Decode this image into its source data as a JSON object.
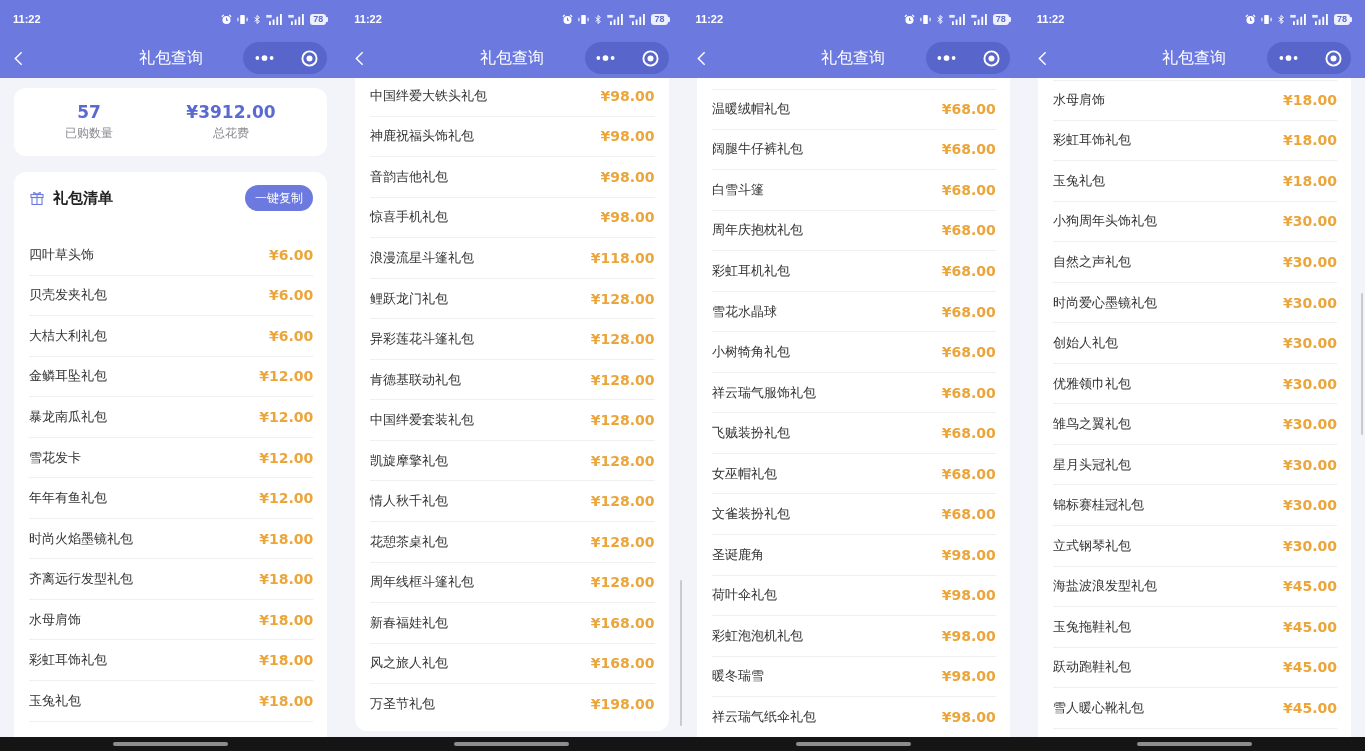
{
  "screens": [
    {
      "status_bar": {
        "time": "11:22",
        "battery": "78"
      },
      "nav_bar": {
        "title": "礼包查询"
      },
      "summary": [
        {
          "value": "57",
          "label": "已购数量"
        },
        {
          "value": "¥3912.00",
          "label": "总花费"
        }
      ],
      "list": {
        "title": "礼包清单",
        "copy_button": "一键复制",
        "items": [
          {
            "name": "四叶草头饰",
            "price": "¥6.00"
          },
          {
            "name": "贝壳发夹礼包",
            "price": "¥6.00"
          },
          {
            "name": "大桔大利礼包",
            "price": "¥6.00"
          },
          {
            "name": "金鳞耳坠礼包",
            "price": "¥12.00"
          },
          {
            "name": "暴龙南瓜礼包",
            "price": "¥12.00"
          },
          {
            "name": "雪花发卡",
            "price": "¥12.00"
          },
          {
            "name": "年年有鱼礼包",
            "price": "¥12.00"
          },
          {
            "name": "时尚火焰墨镜礼包",
            "price": "¥18.00"
          },
          {
            "name": "齐离远行发型礼包",
            "price": "¥18.00"
          },
          {
            "name": "水母肩饰",
            "price": "¥18.00"
          },
          {
            "name": "彩虹耳饰礼包",
            "price": "¥18.00"
          },
          {
            "name": "玉兔礼包",
            "price": "¥18.00"
          }
        ]
      }
    },
    {
      "status_bar": {
        "time": "11:22",
        "battery": "78"
      },
      "nav_bar": {
        "title": "礼包查询"
      },
      "list": {
        "items": [
          {
            "name": "中国绊爱大铁头礼包",
            "price": "¥98.00"
          },
          {
            "name": "神鹿祝福头饰礼包",
            "price": "¥98.00"
          },
          {
            "name": "音韵吉他礼包",
            "price": "¥98.00"
          },
          {
            "name": "惊喜手机礼包",
            "price": "¥98.00"
          },
          {
            "name": "浪漫流星斗篷礼包",
            "price": "¥118.00"
          },
          {
            "name": "鲤跃龙门礼包",
            "price": "¥128.00"
          },
          {
            "name": "异彩莲花斗篷礼包",
            "price": "¥128.00"
          },
          {
            "name": "肯德基联动礼包",
            "price": "¥128.00"
          },
          {
            "name": "中国绊爱套装礼包",
            "price": "¥128.00"
          },
          {
            "name": "凯旋摩擎礼包",
            "price": "¥128.00"
          },
          {
            "name": "情人秋千礼包",
            "price": "¥128.00"
          },
          {
            "name": "花憩茶桌礼包",
            "price": "¥128.00"
          },
          {
            "name": "周年线框斗篷礼包",
            "price": "¥128.00"
          },
          {
            "name": "新春福娃礼包",
            "price": "¥168.00"
          },
          {
            "name": "风之旅人礼包",
            "price": "¥168.00"
          },
          {
            "name": "万圣节礼包",
            "price": "¥198.00"
          }
        ]
      }
    },
    {
      "status_bar": {
        "time": "11:22",
        "battery": "78"
      },
      "nav_bar": {
        "title": "礼包查询"
      },
      "list": {
        "items": [
          {
            "name": "温暖绒帽礼包",
            "price": "¥68.00"
          },
          {
            "name": "阔腿牛仔裤礼包",
            "price": "¥68.00"
          },
          {
            "name": "白雪斗篷",
            "price": "¥68.00"
          },
          {
            "name": "周年庆抱枕礼包",
            "price": "¥68.00"
          },
          {
            "name": "彩虹耳机礼包",
            "price": "¥68.00"
          },
          {
            "name": "雪花水晶球",
            "price": "¥68.00"
          },
          {
            "name": "小树犄角礼包",
            "price": "¥68.00"
          },
          {
            "name": "祥云瑞气服饰礼包",
            "price": "¥68.00"
          },
          {
            "name": "飞贼装扮礼包",
            "price": "¥68.00"
          },
          {
            "name": "女巫帽礼包",
            "price": "¥68.00"
          },
          {
            "name": "文雀装扮礼包",
            "price": "¥68.00"
          },
          {
            "name": "圣诞鹿角",
            "price": "¥98.00"
          },
          {
            "name": "荷叶伞礼包",
            "price": "¥98.00"
          },
          {
            "name": "彩虹泡泡机礼包",
            "price": "¥98.00"
          },
          {
            "name": "暖冬瑞雪",
            "price": "¥98.00"
          },
          {
            "name": "祥云瑞气纸伞礼包",
            "price": "¥98.00"
          }
        ]
      }
    },
    {
      "status_bar": {
        "time": "11:22",
        "battery": "78"
      },
      "nav_bar": {
        "title": "礼包查询"
      },
      "list": {
        "items": [
          {
            "name": "水母肩饰",
            "price": "¥18.00"
          },
          {
            "name": "彩虹耳饰礼包",
            "price": "¥18.00"
          },
          {
            "name": "玉兔礼包",
            "price": "¥18.00"
          },
          {
            "name": "小狗周年头饰礼包",
            "price": "¥30.00"
          },
          {
            "name": "自然之声礼包",
            "price": "¥30.00"
          },
          {
            "name": "时尚爱心墨镜礼包",
            "price": "¥30.00"
          },
          {
            "name": "创始人礼包",
            "price": "¥30.00"
          },
          {
            "name": "优雅领巾礼包",
            "price": "¥30.00"
          },
          {
            "name": "雏鸟之翼礼包",
            "price": "¥30.00"
          },
          {
            "name": "星月头冠礼包",
            "price": "¥30.00"
          },
          {
            "name": "锦标赛桂冠礼包",
            "price": "¥30.00"
          },
          {
            "name": "立式钢琴礼包",
            "price": "¥30.00"
          },
          {
            "name": "海盐波浪发型礼包",
            "price": "¥45.00"
          },
          {
            "name": "玉兔拖鞋礼包",
            "price": "¥45.00"
          },
          {
            "name": "跃动跑鞋礼包",
            "price": "¥45.00"
          },
          {
            "name": "雪人暖心靴礼包",
            "price": "¥45.00"
          }
        ]
      }
    }
  ]
}
